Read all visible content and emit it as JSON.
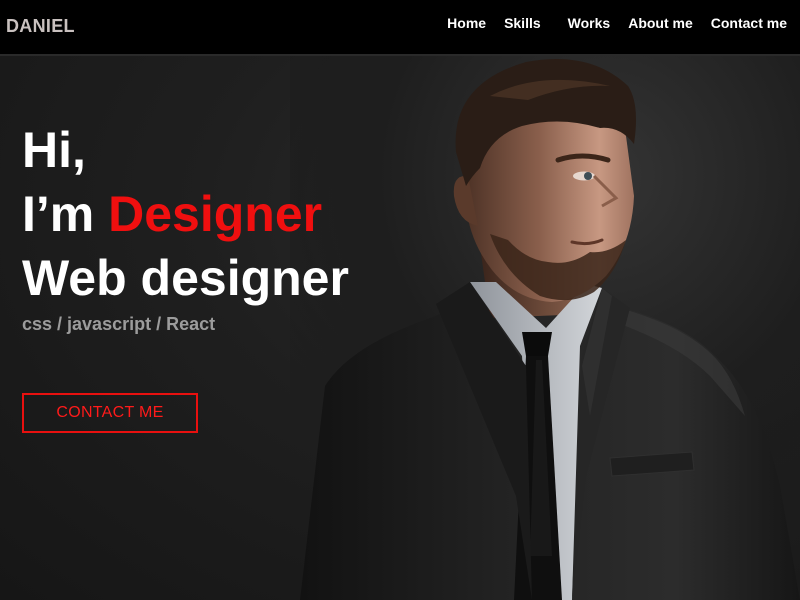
{
  "nav": {
    "brand": "DANIEL",
    "links": [
      "Home",
      "Skills",
      "Works",
      "About me",
      "Contact me"
    ]
  },
  "hero": {
    "greeting": "Hi,",
    "intro_prefix": "I’m ",
    "intro_highlight": "Designer",
    "role": "Web designer",
    "skills": "css / javascript / React",
    "cta_label": "CONTACT ME"
  },
  "colors": {
    "accent": "#f00f0f",
    "navbar_bg": "#000000",
    "page_bg": "#1b1b1b",
    "brand_text": "#c9c1bf",
    "skills_text": "#9c9c9c"
  },
  "icons": {
    "portrait": "portrait-photo"
  }
}
